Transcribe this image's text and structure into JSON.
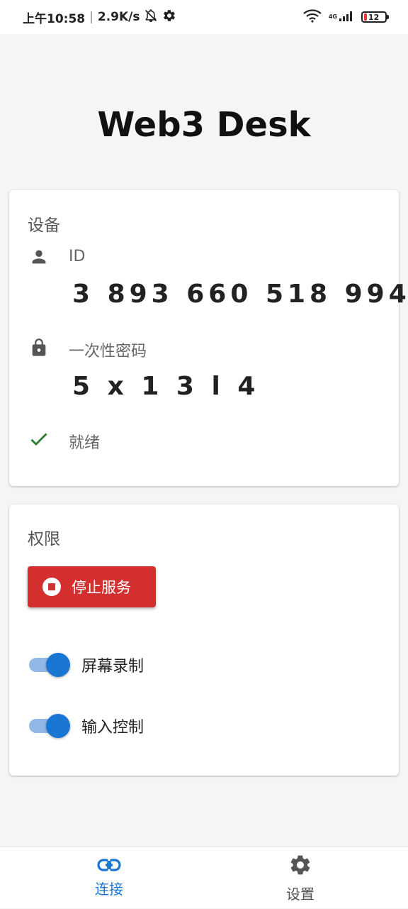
{
  "status_bar": {
    "time": "上午10:58",
    "speed": "2.9K/s",
    "network": "4G",
    "battery": "12"
  },
  "app": {
    "title": "Web3 Desk"
  },
  "device_card": {
    "title": "设备",
    "id_label": "ID",
    "id_value": "3 893 660 518 994",
    "password_label": "一次性密码",
    "password_value": "5 x 1 3 l 4",
    "status": "就绪"
  },
  "permission_card": {
    "title": "权限",
    "stop_button": "停止服务",
    "screen_record": {
      "label": "屏幕录制",
      "enabled": true
    },
    "input_control": {
      "label": "输入控制",
      "enabled": true
    }
  },
  "bottom_nav": {
    "connect": "连接",
    "settings": "设置"
  },
  "colors": {
    "accent": "#1976d2",
    "danger": "#d32f2f",
    "success": "#2e7d32",
    "background": "#f5f5f5"
  }
}
